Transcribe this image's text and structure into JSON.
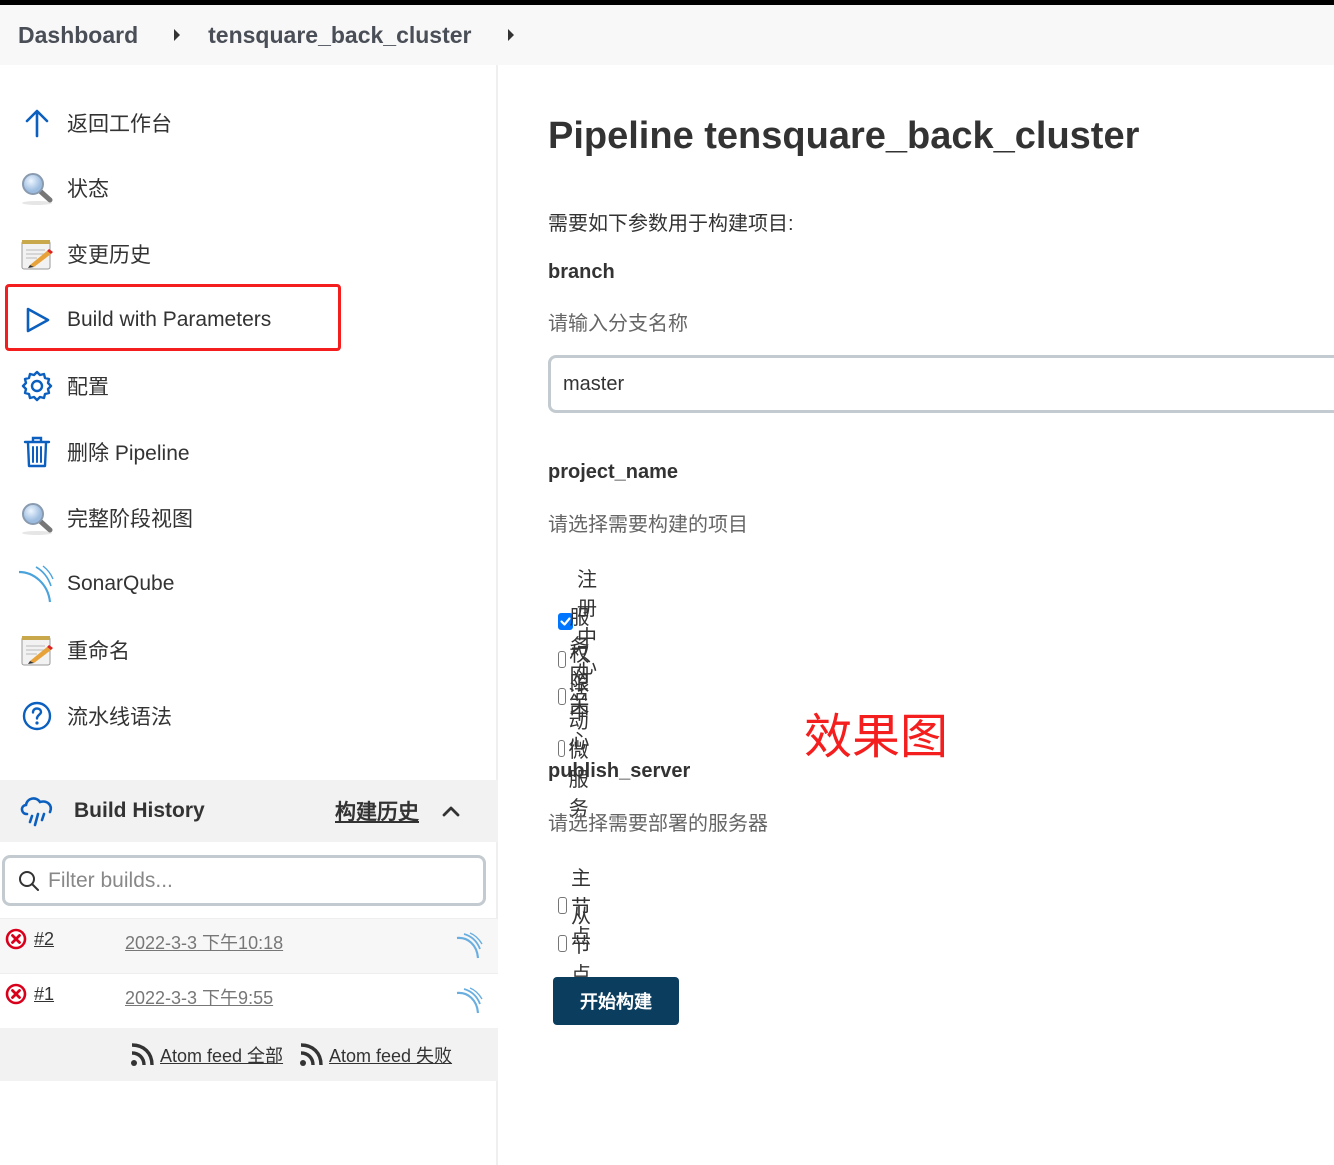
{
  "breadcrumb": {
    "items": [
      "Dashboard",
      "tensquare_back_cluster"
    ]
  },
  "sidebar": {
    "tasks": [
      {
        "label": "返回工作台",
        "icon": "arrow-up-icon"
      },
      {
        "label": "状态",
        "icon": "magnifier-icon"
      },
      {
        "label": "变更历史",
        "icon": "notepad-icon"
      },
      {
        "label": "Build with Parameters",
        "icon": "play-icon",
        "highlighted": true
      },
      {
        "label": "配置",
        "icon": "gear-icon"
      },
      {
        "label": "删除 Pipeline",
        "icon": "trash-icon"
      },
      {
        "label": "完整阶段视图",
        "icon": "magnifier-icon"
      },
      {
        "label": "SonarQube",
        "icon": "sonarqube-icon"
      },
      {
        "label": "重命名",
        "icon": "notepad-icon"
      },
      {
        "label": "流水线语法",
        "icon": "help-icon"
      }
    ],
    "highlight_color": "#f41e1e"
  },
  "build_history": {
    "title": "Build History",
    "link_label": "构建历史",
    "filter_placeholder": "Filter builds...",
    "builds": [
      {
        "number": "#2",
        "date": "2022-3-3 下午10:18",
        "status": "failed"
      },
      {
        "number": "#1",
        "date": "2022-3-3 下午9:55",
        "status": "failed"
      }
    ],
    "feeds": [
      "Atom feed 全部",
      "Atom feed 失败"
    ]
  },
  "main": {
    "title": "Pipeline tensquare_back_cluster",
    "intro": "需要如下参数用于构建项目:",
    "params": [
      {
        "name": "branch",
        "description": "请输入分支名称",
        "type": "text",
        "value": "master"
      },
      {
        "name": "project_name",
        "description": "请选择需要构建的项目",
        "type": "checkbox",
        "options": [
          {
            "label": "注册中心",
            "checked": true
          },
          {
            "label": "服务网关",
            "checked": false
          },
          {
            "label": "权限中心",
            "checked": false
          },
          {
            "label": "活动微服务",
            "checked": false
          }
        ]
      },
      {
        "name": "publish_server",
        "description": "请选择需要部署的服务器",
        "type": "checkbox",
        "options": [
          {
            "label": "主节点",
            "checked": false
          },
          {
            "label": "从节点",
            "checked": false
          }
        ]
      }
    ],
    "watermark": "效果图",
    "build_button": "开始构建"
  },
  "colors": {
    "accent_blue": "#0b5fbf",
    "button_bg": "#0b3d5e",
    "checkbox_checked": "#0075ff",
    "fail_red": "#d9001b",
    "watermark_red": "#f41e1e"
  }
}
